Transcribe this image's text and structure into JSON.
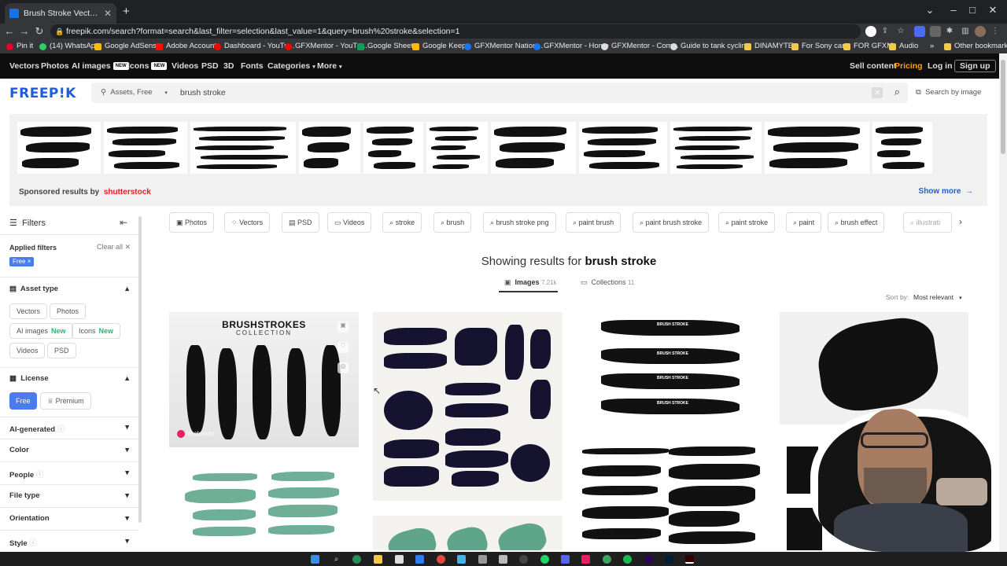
{
  "browser": {
    "tab_title": "Brush Stroke Vectors, Photos and PSD files",
    "new_tab": "+",
    "url": "freepik.com/search?format=search&last_filter=selection&last_value=1&query=brush%20stroke&selection=1",
    "window_controls": [
      "⌄",
      "–",
      "□",
      "✕"
    ]
  },
  "bookmarks": [
    {
      "label": "Pin it",
      "color": "#e60023"
    },
    {
      "label": "(14) WhatsApp",
      "color": "#25d366"
    },
    {
      "label": "Google AdSense",
      "color": "#fbbc04"
    },
    {
      "label": "Adobe Account",
      "color": "#fa0f00"
    },
    {
      "label": "Dashboard - YouTu...",
      "color": "#ff0000"
    },
    {
      "label": "GFXMentor - YouTu...",
      "color": "#ff0000"
    },
    {
      "label": "Google Sheets",
      "color": "#0f9d58"
    },
    {
      "label": "Google Keep",
      "color": "#fbbc04"
    },
    {
      "label": "GFXMentor Nation...",
      "color": "#1877f2"
    },
    {
      "label": "GFXMentor - Home",
      "color": "#1877f2"
    },
    {
      "label": "GFXMentor - Com...",
      "color": "#dddddd"
    },
    {
      "label": "Guide to tank cyclin...",
      "color": "#dddddd"
    },
    {
      "label": "DINAMYTE",
      "color": "#f2c94c"
    },
    {
      "label": "For Sony cam",
      "color": "#f2c94c"
    },
    {
      "label": "FOR GFXM",
      "color": "#f2c94c"
    },
    {
      "label": "Audio",
      "color": "#f2c94c"
    },
    {
      "label": "»",
      "color": ""
    },
    {
      "label": "Other bookmarks",
      "color": "#f2c94c"
    }
  ],
  "site_nav": {
    "items": [
      "Vectors",
      "Photos",
      "AI images",
      "Icons",
      "Videos",
      "PSD",
      "3D",
      "Fonts",
      "Categories",
      "More"
    ],
    "new_badge": "NEW",
    "right": [
      "Sell content",
      "Pricing",
      "Log in",
      "Sign up"
    ]
  },
  "header": {
    "logo": "FREEP!K",
    "asset_filter": "Assets, Free",
    "query": "brush stroke",
    "search_by_image": "Search by image"
  },
  "sponsored": {
    "label": "Sponsored results by",
    "brand": "shutterstock",
    "show_more": "Show more"
  },
  "sidebar": {
    "title": "Filters",
    "applied_filters": "Applied filters",
    "clear_all": "Clear all",
    "free_chip": "Free",
    "asset_type": "Asset type",
    "asset_types": [
      "Vectors",
      "Photos",
      "AI images",
      "Icons",
      "Videos",
      "PSD"
    ],
    "new_label": "New",
    "license": "License",
    "license_free": "Free",
    "license_premium": "Premium",
    "facets": [
      "AI-generated",
      "Color",
      "People",
      "File type",
      "Orientation",
      "Style"
    ]
  },
  "filter_chips": [
    "Photos",
    "Vectors",
    "PSD",
    "Videos",
    "stroke",
    "brush",
    "brush stroke png",
    "paint brush",
    "paint brush stroke",
    "paint stroke",
    "paint",
    "brush effect",
    "illustrati"
  ],
  "results": {
    "prefix": "Showing results for",
    "query": "brush stroke",
    "tab_images": "Images",
    "images_count": "7.21k",
    "tab_collections": "Collections",
    "collections_count": "11",
    "sort_label": "Sort by:",
    "sort_value": "Most relevant"
  },
  "cards": {
    "card1_title": "BRUSHSTROKES",
    "card1_sub": "COLLECTION",
    "card1_author": "Vectorium",
    "card3_labels": [
      "BRUSH STROKE",
      "BRUSH STROKE",
      "BRUSH STROKE",
      "BRUSH STROKE"
    ]
  },
  "colors": {
    "brand_blue": "#1f5ed8",
    "pricing_orange": "#ff9e1b",
    "new_green": "#2bb673",
    "mint": "#6fae97"
  }
}
